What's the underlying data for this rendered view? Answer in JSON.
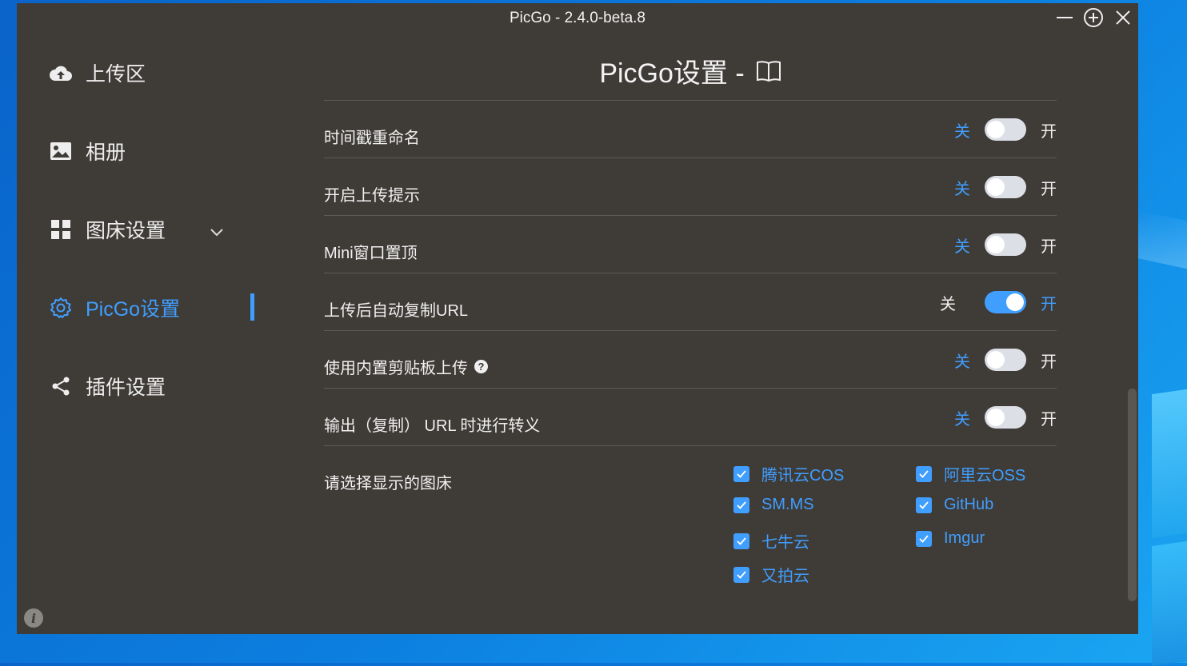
{
  "window": {
    "title": "PicGo - 2.4.0-beta.8"
  },
  "sidebar": {
    "items": [
      {
        "label": "上传区",
        "icon": "cloud-upload-icon"
      },
      {
        "label": "相册",
        "icon": "image-icon"
      },
      {
        "label": "图床设置",
        "icon": "grid-icon"
      },
      {
        "label": "PicGo设置",
        "icon": "gear-icon"
      },
      {
        "label": "插件设置",
        "icon": "share-icon"
      }
    ],
    "active_index": 3
  },
  "main": {
    "title": "PicGo设置 -",
    "settings": [
      {
        "label": "时间戳重命名",
        "off_label": "关",
        "on_label": "开",
        "enabled": false
      },
      {
        "label": "开启上传提示",
        "off_label": "关",
        "on_label": "开",
        "enabled": false
      },
      {
        "label": "Mini窗口置顶",
        "off_label": "关",
        "on_label": "开",
        "enabled": false
      },
      {
        "label": "上传后自动复制URL",
        "off_label": "关",
        "on_label": "开",
        "enabled": true
      },
      {
        "label": "使用内置剪贴板上传",
        "off_label": "关",
        "on_label": "开",
        "enabled": false
      },
      {
        "label": "输出（复制） URL 时进行转义",
        "off_label": "关",
        "on_label": "开",
        "enabled": false
      }
    ],
    "picker": {
      "label": "请选择显示的图床",
      "options": [
        {
          "label": "腾讯云COS",
          "checked": true
        },
        {
          "label": "阿里云OSS",
          "checked": true
        },
        {
          "label": "SM.MS",
          "checked": true
        },
        {
          "label": "GitHub",
          "checked": true
        },
        {
          "label": "七牛云",
          "checked": true
        },
        {
          "label": "Imgur",
          "checked": true
        },
        {
          "label": "又拍云",
          "checked": true
        }
      ]
    }
  },
  "colors": {
    "accent": "#409eff",
    "background": "#3f3b37",
    "switch_off": "#dcdfe6"
  }
}
